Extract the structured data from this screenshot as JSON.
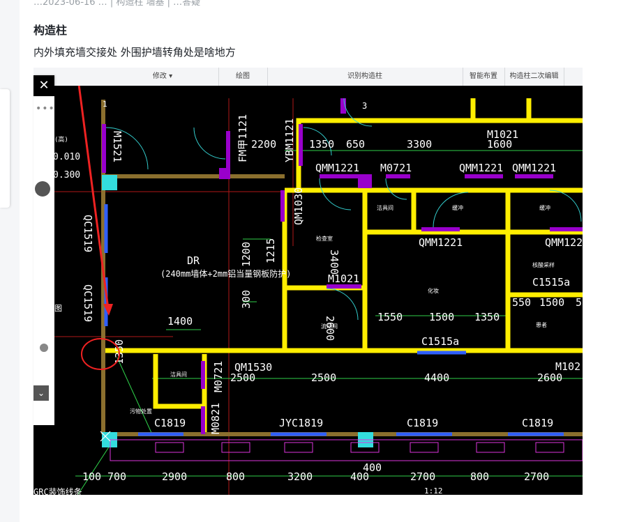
{
  "post": {
    "meta_text": "…2023-06-16 …  |  构造柱  墙基  |  …答疑",
    "title": "构造柱",
    "body": "内外填充墙交接处 外围护墙转角处是啥地方"
  },
  "toolbar": {
    "tabs": [
      "修改 ▾",
      "绘图",
      "识别构造柱",
      "智能布置",
      "构造柱二次编辑"
    ]
  },
  "cad": {
    "labels": {
      "m1521": "M1521",
      "qc1519a": "QC1519",
      "qc1519b": "QC1519",
      "elev1": "0.010",
      "elev2": "0.300",
      "fm": "FM甲1121",
      "ybm": "YBM1121",
      "d2200": "2200",
      "d1350": "1350",
      "d650": "650",
      "d3300": "3300",
      "m1021a": "M1021",
      "d1600": "1600",
      "qmm1221a": "QMM1221",
      "m0721a": "M0721",
      "qmm1221b": "QMM1221",
      "qmm1221c": "QMM1221",
      "qm1030": "QM1030",
      "qmm1221d": "QMM1221",
      "qmm122e": "QMM122",
      "dr": "DR",
      "dr_note": "(240mm墙体+2mm铝当量钢板防护)",
      "d1200": "1200",
      "d1215": "1215",
      "d300": "300",
      "d3400": "3400",
      "m1021b": "M1021",
      "c1515a": "C1515a",
      "d1400": "1400",
      "d1550": "1550",
      "d1500": "1500",
      "d1350b": "1350",
      "d550": "550",
      "d1500b": "1500",
      "d5": "5",
      "c1515b": "C1515a",
      "d2600b": "2600",
      "qm1530": "QM1530",
      "m0721b": "M0721",
      "d2500a": "2500",
      "d2500b": "2500",
      "d4400": "4400",
      "d2600": "2600",
      "m102": "M102",
      "d1350c": "1350",
      "m0821": "M0821",
      "c1819a": "C1819",
      "jyc1819": "JYC1819",
      "c1819b": "C1819",
      "c1819c": "C1819",
      "b100": "100",
      "b700": "700",
      "b2900": "2900",
      "b800": "800",
      "b3200": "3200",
      "b400": "400",
      "b400b": "400",
      "b2700": "2700",
      "b800b": "800",
      "b2700b": "2700",
      "grc": "GRC装饰线条",
      "scale": "1:12",
      "num1": "1",
      "num3": "3",
      "room_jiechu": "洁具间",
      "room_huanchong": "缓冲",
      "room_huanchong2": "缓冲",
      "room_huazhuang": "化妆",
      "room_huanzhe": "患者",
      "room_cangchu": "洁具间",
      "room_wuwu": "污物处置",
      "room_jianbian": "检查室",
      "room_liuliang": "流动间",
      "room_tu": "图",
      "room_gao": "(高)",
      "room_jiance": "核酸采样"
    }
  },
  "colors": {
    "cad_bg": "#000000",
    "wall_yellow": "#ffee00",
    "wall_brown": "#8b6f2e",
    "door_cyan": "#33cccc",
    "dim_green": "#33ee55",
    "window_blue": "#3366ff",
    "column_purple": "#9900cc",
    "annotation_red": "#ee2222"
  },
  "float_panel": {
    "close_icon": "close-icon",
    "down_icon": "chevron-down-icon"
  }
}
